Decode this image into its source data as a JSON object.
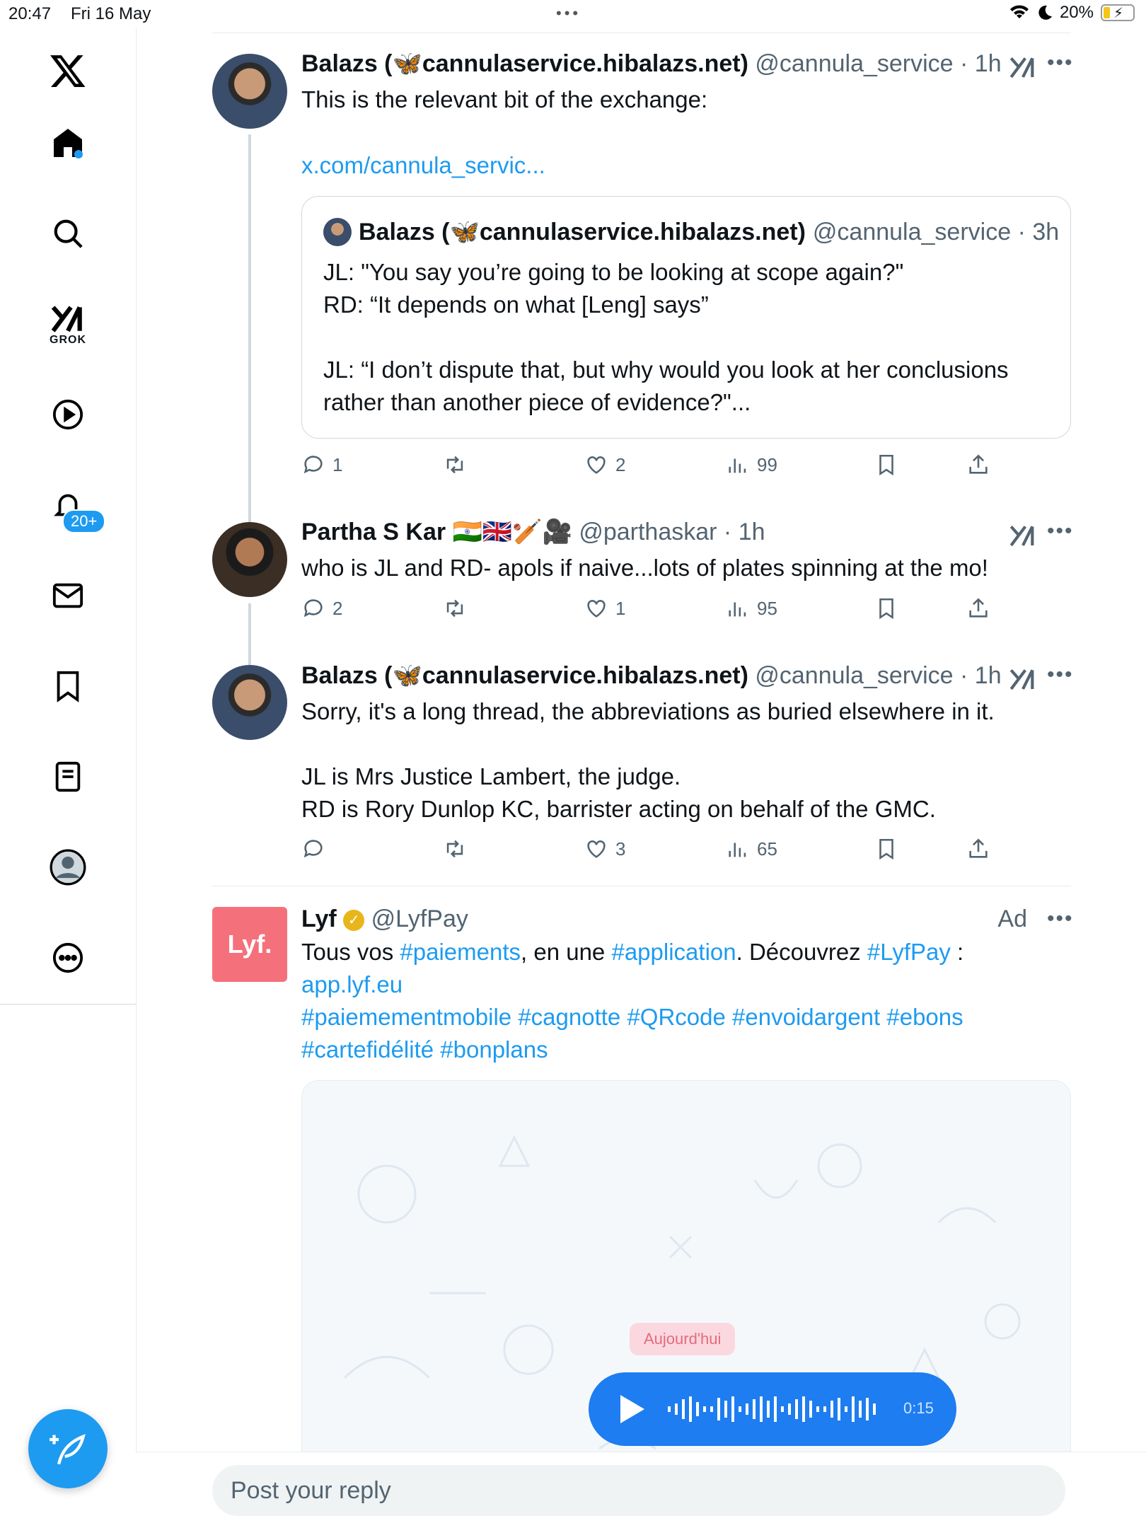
{
  "status_bar": {
    "time": "20:47",
    "date": "Fri 16 May",
    "battery": "20%"
  },
  "sidebar": {
    "grok_label": "GROK",
    "notifications_badge": "20+"
  },
  "tweets": [
    {
      "name": "Balazs (🦋cannulaservice.hibalazs.net)",
      "handle": "@cannula_service",
      "time": "1h",
      "body": "This is the relevant bit of the exchange:",
      "link": "x.com/cannula_servic...",
      "quote": {
        "name": "Balazs (🦋cannulaservice.hibalazs.net)",
        "handle": "@cannula_service",
        "time": "3h",
        "body": "JL: \"You say you’re going to be looking at scope again?\"\nRD: “It depends on what [Leng] says”\n\nJL: “I don’t dispute that, but why would you look at her conclusions rather than another piece of evidence?\"..."
      },
      "replies": "1",
      "reposts": "",
      "likes": "2",
      "views": "99"
    },
    {
      "name": "Partha S Kar 🇮🇳🇬🇧🏏🎥",
      "handle": "@parthaskar",
      "time": "1h",
      "body": "who is JL and RD- apols if naive...lots of plates spinning at the mo!",
      "replies": "2",
      "reposts": "",
      "likes": "1",
      "views": "95"
    },
    {
      "name": "Balazs (🦋cannulaservice.hibalazs.net)",
      "handle": "@cannula_service",
      "time": "1h",
      "body": "Sorry, it's a long thread, the abbreviations as buried elsewhere in it.\n\nJL is Mrs Justice Lambert, the judge.\nRD is Rory Dunlop KC, barrister acting on behalf of the GMC.",
      "replies": "",
      "reposts": "",
      "likes": "3",
      "views": "65"
    }
  ],
  "ad": {
    "name": "Lyf",
    "handle": "@LyfPay",
    "ad_label": "Ad",
    "logo_text": "Lyf.",
    "text_1": "Tous vos ",
    "tag_1": "#paiements",
    "text_2": ", en une ",
    "tag_2": "#application",
    "text_3": ". Découvrez ",
    "tag_3": "#LyfPay",
    "text_4": " :",
    "link": "app.lyf.eu",
    "tags_line1": "#paiemementmobile #cagnotte #QRcode #envoidargent #ebons",
    "tags_line2": "#cartefidélité #bonplans",
    "media_pill": "Aujourd'hui",
    "audio_duration": "0:15"
  },
  "reply": {
    "placeholder": "Post your reply"
  },
  "sep": " · "
}
